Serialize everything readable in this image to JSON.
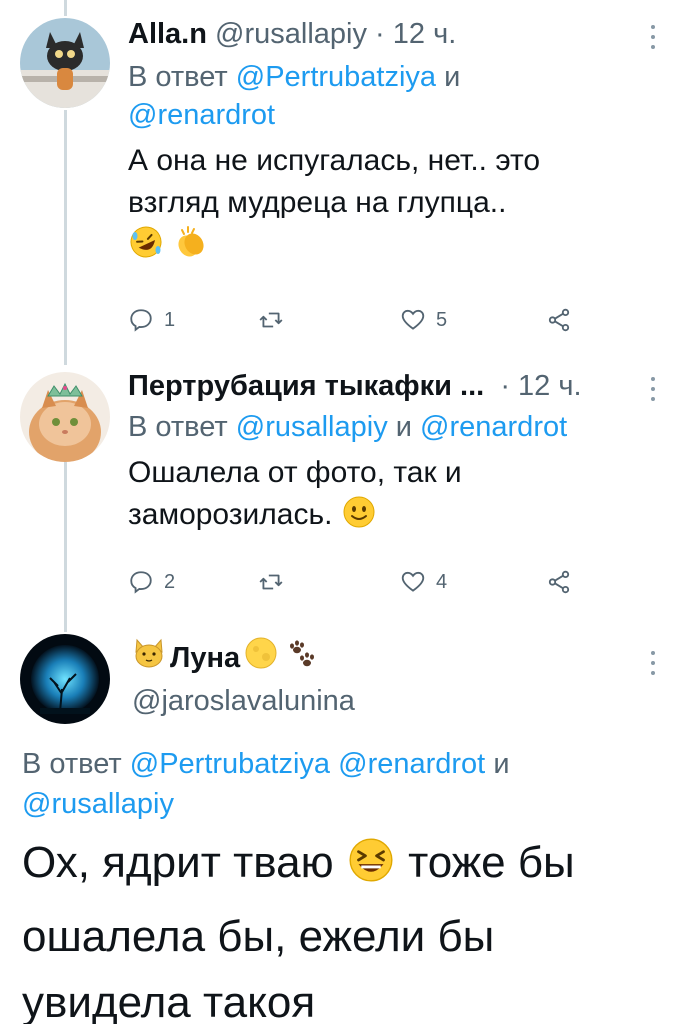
{
  "tweets": [
    {
      "display_name": "Alla.n",
      "handle": "@rusallapiy",
      "time": "12 ч.",
      "reply_prefix": "В ответ",
      "reply_mention_1": "@Pertrubatziya",
      "reply_and": "и",
      "reply_mention_2": "@renardrot",
      "text": "А она не испугалась, нет.. это взгляд мудреца на глупца..",
      "emojis": [
        "rolling-laughing-emoji",
        "clapping-hands-emoji"
      ],
      "replies": "1",
      "retweets": "",
      "likes": "5"
    },
    {
      "display_name": "Пертрубация тыкафки ...",
      "time": "12 ч.",
      "reply_prefix": "В ответ",
      "reply_mention_1": "@rusallapiy",
      "reply_and": "и",
      "reply_mention_2": "@renardrot",
      "text": "Ошалела от фото, так и заморозилась.",
      "emojis": [
        "slightly-smiling-face-emoji"
      ],
      "replies": "2",
      "retweets": "",
      "likes": "4"
    }
  ],
  "main_tweet": {
    "display_name": "Луна",
    "name_emojis": [
      "cat-face-emoji",
      "full-moon-emoji",
      "paw-prints-emoji"
    ],
    "handle": "@jaroslavalunina",
    "reply_prefix": "В ответ",
    "reply_mention_1": "@Pertrubatziya",
    "reply_mention_2": "@renardrot",
    "reply_and": "и",
    "reply_mention_3": "@rusallapiy",
    "text_part_1": "Ох, ядрит тваю",
    "text_emoji": "grinning-squinting-face-emoji",
    "text_part_2": "тоже бы ошалела бы, ежели бы увидела такоя"
  },
  "colors": {
    "link": "#1d9bf0",
    "secondary": "#536471",
    "primary": "#0f1419",
    "thread_line": "#cfd9de"
  }
}
